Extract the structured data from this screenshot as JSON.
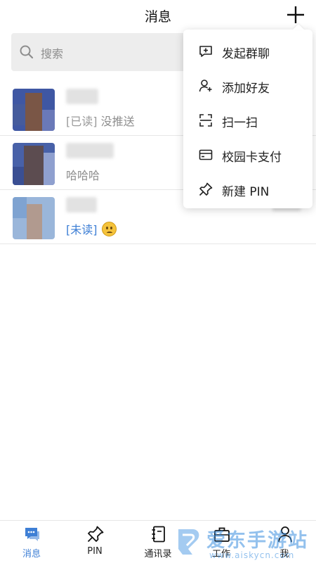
{
  "header": {
    "title": "消息",
    "plus_icon": "plus-icon"
  },
  "search": {
    "placeholder": "搜索",
    "icon": "search-icon"
  },
  "chats": [
    {
      "status": "[已读]",
      "message": "没推送"
    },
    {
      "status": "",
      "message": "哈哈哈"
    },
    {
      "status": "[未读]",
      "message": "",
      "emoji": "worried-face"
    }
  ],
  "menu": {
    "items": [
      {
        "label": "发起群聊",
        "icon": "chat-add-icon"
      },
      {
        "label": "添加好友",
        "icon": "add-friend-icon"
      },
      {
        "label": "扫一扫",
        "icon": "scan-icon"
      },
      {
        "label": "校园卡支付",
        "icon": "card-icon"
      },
      {
        "label": "新建 PIN",
        "icon": "pin-icon"
      }
    ]
  },
  "tabs": [
    {
      "label": "消息",
      "icon": "messages-icon",
      "active": true
    },
    {
      "label": "PIN",
      "icon": "pin-icon"
    },
    {
      "label": "通讯录",
      "icon": "contacts-icon"
    },
    {
      "label": "工作",
      "icon": "briefcase-icon"
    },
    {
      "label": "我",
      "icon": "person-icon"
    }
  ],
  "watermark": {
    "text": "爱东手游站",
    "url": "www.aiskycn.com"
  },
  "colors": {
    "accent": "#3e7fd5",
    "unread": "#3e7fd5",
    "text_secondary": "#8e8e8e",
    "search_bg": "#ededed"
  }
}
